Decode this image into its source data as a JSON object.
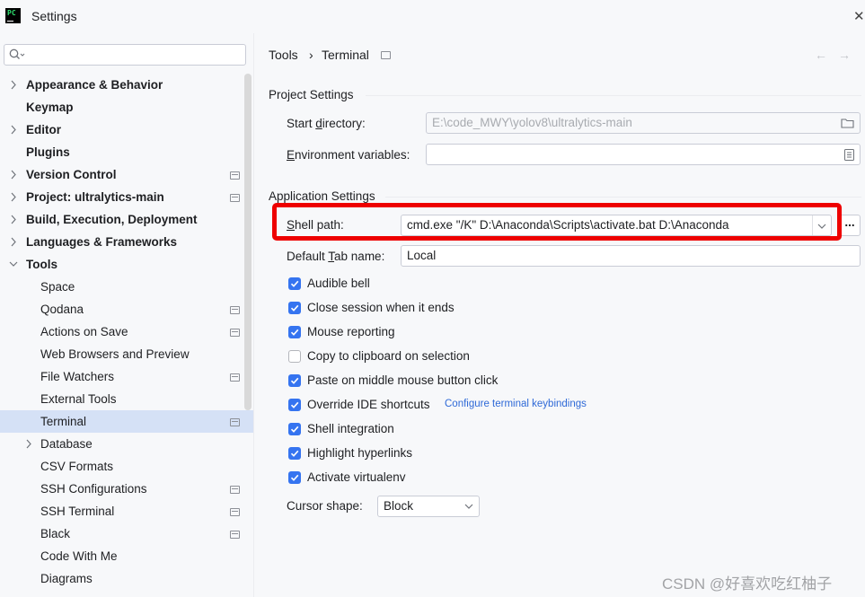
{
  "window": {
    "title": "Settings",
    "app_logo_text": "PC"
  },
  "sidebar": {
    "search": {
      "placeholder": "",
      "value": ""
    },
    "items": [
      {
        "label": "Appearance & Behavior",
        "level": 0,
        "arrow": "right",
        "proj": false,
        "selected": false
      },
      {
        "label": "Keymap",
        "level": 0,
        "arrow": "",
        "proj": false,
        "selected": false
      },
      {
        "label": "Editor",
        "level": 0,
        "arrow": "right",
        "proj": false,
        "selected": false
      },
      {
        "label": "Plugins",
        "level": 0,
        "arrow": "",
        "proj": false,
        "selected": false
      },
      {
        "label": "Version Control",
        "level": 0,
        "arrow": "right",
        "proj": true,
        "selected": false
      },
      {
        "label": "Project: ultralytics-main",
        "level": 0,
        "arrow": "right",
        "proj": true,
        "selected": false
      },
      {
        "label": "Build, Execution, Deployment",
        "level": 0,
        "arrow": "right",
        "proj": false,
        "selected": false
      },
      {
        "label": "Languages & Frameworks",
        "level": 0,
        "arrow": "right",
        "proj": false,
        "selected": false
      },
      {
        "label": "Tools",
        "level": 0,
        "arrow": "down",
        "proj": false,
        "selected": false
      },
      {
        "label": "Space",
        "level": 1,
        "arrow": "",
        "proj": false,
        "selected": false
      },
      {
        "label": "Qodana",
        "level": 1,
        "arrow": "",
        "proj": true,
        "selected": false
      },
      {
        "label": "Actions on Save",
        "level": 1,
        "arrow": "",
        "proj": true,
        "selected": false
      },
      {
        "label": "Web Browsers and Preview",
        "level": 1,
        "arrow": "",
        "proj": false,
        "selected": false
      },
      {
        "label": "File Watchers",
        "level": 1,
        "arrow": "",
        "proj": true,
        "selected": false
      },
      {
        "label": "External Tools",
        "level": 1,
        "arrow": "",
        "proj": false,
        "selected": false
      },
      {
        "label": "Terminal",
        "level": 1,
        "arrow": "",
        "proj": true,
        "selected": true
      },
      {
        "label": "Database",
        "level": 1,
        "arrow": "right",
        "proj": false,
        "selected": false
      },
      {
        "label": "CSV Formats",
        "level": 1,
        "arrow": "",
        "proj": false,
        "selected": false
      },
      {
        "label": "SSH Configurations",
        "level": 1,
        "arrow": "",
        "proj": true,
        "selected": false
      },
      {
        "label": "SSH Terminal",
        "level": 1,
        "arrow": "",
        "proj": true,
        "selected": false
      },
      {
        "label": "Black",
        "level": 1,
        "arrow": "",
        "proj": true,
        "selected": false
      },
      {
        "label": "Code With Me",
        "level": 1,
        "arrow": "",
        "proj": false,
        "selected": false
      },
      {
        "label": "Diagrams",
        "level": 1,
        "arrow": "",
        "proj": false,
        "selected": false
      }
    ]
  },
  "breadcrumb": {
    "parent": "Tools",
    "separator": "›",
    "current": "Terminal"
  },
  "project_settings": {
    "section_title": "Project Settings",
    "start_directory": {
      "label_pre": "Start ",
      "label_mnemonic": "d",
      "label_post": "irectory:",
      "value": "E:\\code_MWY\\yolov8\\ultralytics-main"
    },
    "env_vars": {
      "label_mnemonic": "E",
      "label_post": "nvironment variables:",
      "value": ""
    }
  },
  "app_settings": {
    "section_title": "Application Settings",
    "shell_path": {
      "label_mnemonic": "S",
      "label_post": "hell path:",
      "value": "cmd.exe \"/K\" D:\\Anaconda\\Scripts\\activate.bat D:\\Anaconda",
      "more": "..."
    },
    "default_tab": {
      "label_pre": "Default ",
      "label_mnemonic": "T",
      "label_post": "ab name:",
      "value": "Local"
    },
    "checkboxes": [
      {
        "label": "Audible bell",
        "checked": true
      },
      {
        "label": "Close session when it ends",
        "checked": true
      },
      {
        "label": "Mouse reporting",
        "checked": true
      },
      {
        "label": "Copy to clipboard on selection",
        "checked": false
      },
      {
        "label": "Paste on middle mouse button click",
        "checked": true
      },
      {
        "label": "Override IDE shortcuts",
        "checked": true,
        "link": "Configure terminal keybindings"
      },
      {
        "label": "Shell integration",
        "checked": true
      },
      {
        "label": "Highlight hyperlinks",
        "checked": true
      },
      {
        "label": "Activate virtualenv",
        "checked": true
      }
    ],
    "cursor_shape": {
      "label": "Cursor shape:",
      "value": "Block"
    }
  },
  "watermark": "CSDN @好喜欢吃红柚子",
  "colors": {
    "accent": "#3574f0",
    "selection": "#d5e1f6",
    "highlight_box": "#ee0000",
    "link": "#2e69d7"
  },
  "icons": {
    "search": "search-icon",
    "folder": "folder-icon",
    "list": "list-icon",
    "checkmark": "checkmark-icon"
  }
}
